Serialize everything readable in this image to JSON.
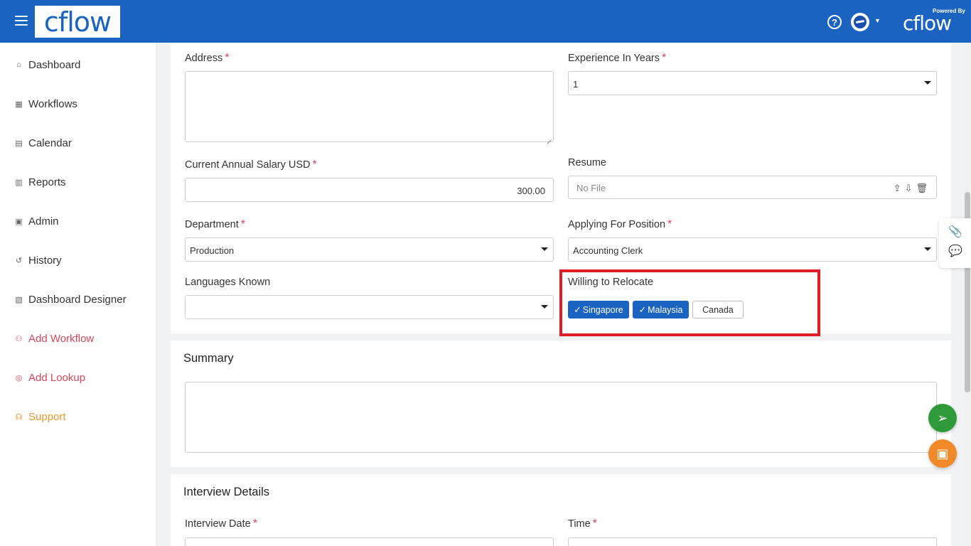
{
  "header": {
    "logo_text": "cflow",
    "help_glyph": "?",
    "powered_by": "Powered By",
    "powered_logo": "cflow"
  },
  "sidebar": {
    "items": [
      {
        "label": "Dashboard",
        "icon": "home-icon"
      },
      {
        "label": "Workflows",
        "icon": "grid-icon"
      },
      {
        "label": "Calendar",
        "icon": "calendar-icon"
      },
      {
        "label": "Reports",
        "icon": "report-icon"
      },
      {
        "label": "Admin",
        "icon": "admin-icon"
      },
      {
        "label": "History",
        "icon": "history-icon"
      },
      {
        "label": "Dashboard Designer",
        "icon": "designer-icon"
      },
      {
        "label": "Add Workflow",
        "icon": "workflow-icon"
      },
      {
        "label": "Add Lookup",
        "icon": "lookup-icon"
      },
      {
        "label": "Support",
        "icon": "headset-icon"
      }
    ]
  },
  "form": {
    "address": {
      "label": "Address",
      "required": "*",
      "value": ""
    },
    "experience": {
      "label": "Experience In Years",
      "required": "*",
      "value": "1"
    },
    "salary": {
      "label": "Current Annual Salary USD",
      "required": "*",
      "value": "300.00"
    },
    "resume": {
      "label": "Resume",
      "placeholder": "No File"
    },
    "department": {
      "label": "Department",
      "required": "*",
      "value": "Production"
    },
    "position": {
      "label": "Applying For Position",
      "required": "*",
      "value": "Accounting Clerk"
    },
    "languages": {
      "label": "Languages Known",
      "value": ""
    },
    "relocate": {
      "label": "Willing to Relocate",
      "options": [
        {
          "label": "Singapore",
          "selected": true
        },
        {
          "label": "Malaysia",
          "selected": true
        },
        {
          "label": "Canada",
          "selected": false
        }
      ]
    }
  },
  "summary": {
    "title": "Summary",
    "value": ""
  },
  "interview": {
    "title": "Interview Details",
    "date": {
      "label": "Interview Date",
      "required": "*"
    },
    "time": {
      "label": "Time",
      "required": "*"
    }
  },
  "colors": {
    "header_bg": "#1a63c0",
    "accent_red": "#d9445a",
    "support_orange": "#f0962c",
    "highlight": "#e01d24",
    "send_green": "#2e9a3a",
    "save_orange": "#f28a2a"
  }
}
